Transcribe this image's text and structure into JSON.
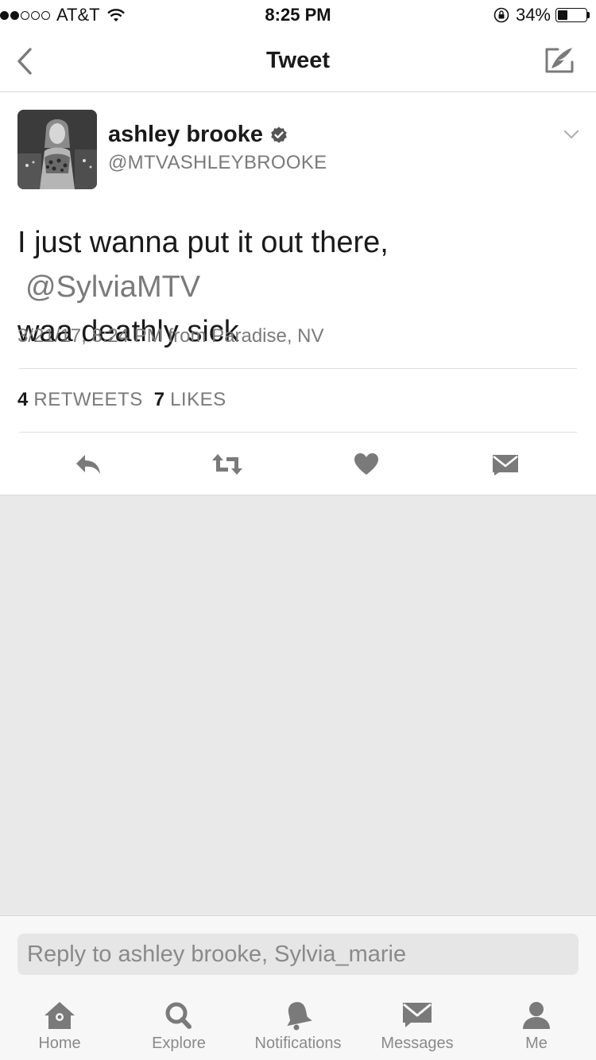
{
  "status_bar": {
    "carrier": "AT&T",
    "time": "8:25 PM",
    "battery_percent": "34%",
    "battery_level": 0.34,
    "signal_bars_filled": 2,
    "signal_bars_total": 5
  },
  "nav": {
    "title": "Tweet",
    "back_icon": "chevron-left-icon",
    "compose_icon": "compose-quill-icon"
  },
  "tweet": {
    "author_name": "ashley brooke",
    "author_handle": "@MTVASHLEYBROOKE",
    "verified": true,
    "text_before": "I just wanna put it out there,",
    "mention": "@SylviaMTV",
    "text_after": "waa deathly sick",
    "meta": "3/21/17, 8:24 PM from Paradise, NV",
    "retweets_count": "4",
    "retweets_label": "RETWEETS",
    "likes_count": "7",
    "likes_label": "LIKES",
    "actions": [
      "reply-icon",
      "retweet-icon",
      "heart-icon",
      "envelope-icon"
    ]
  },
  "reply": {
    "placeholder": "Reply to ashley brooke, Sylvia_marie"
  },
  "tabs": [
    {
      "label": "Home",
      "icon": "home-icon"
    },
    {
      "label": "Explore",
      "icon": "search-icon"
    },
    {
      "label": "Notifications",
      "icon": "bell-icon"
    },
    {
      "label": "Messages",
      "icon": "envelope-icon"
    },
    {
      "label": "Me",
      "icon": "person-icon"
    }
  ],
  "colors": {
    "text_primary": "#1a1a1a",
    "text_secondary": "#7a7a7a",
    "icon_gray": "#7a7a7a",
    "empty_bg": "#e9e9e9",
    "bar_bg": "#f7f7f7"
  }
}
